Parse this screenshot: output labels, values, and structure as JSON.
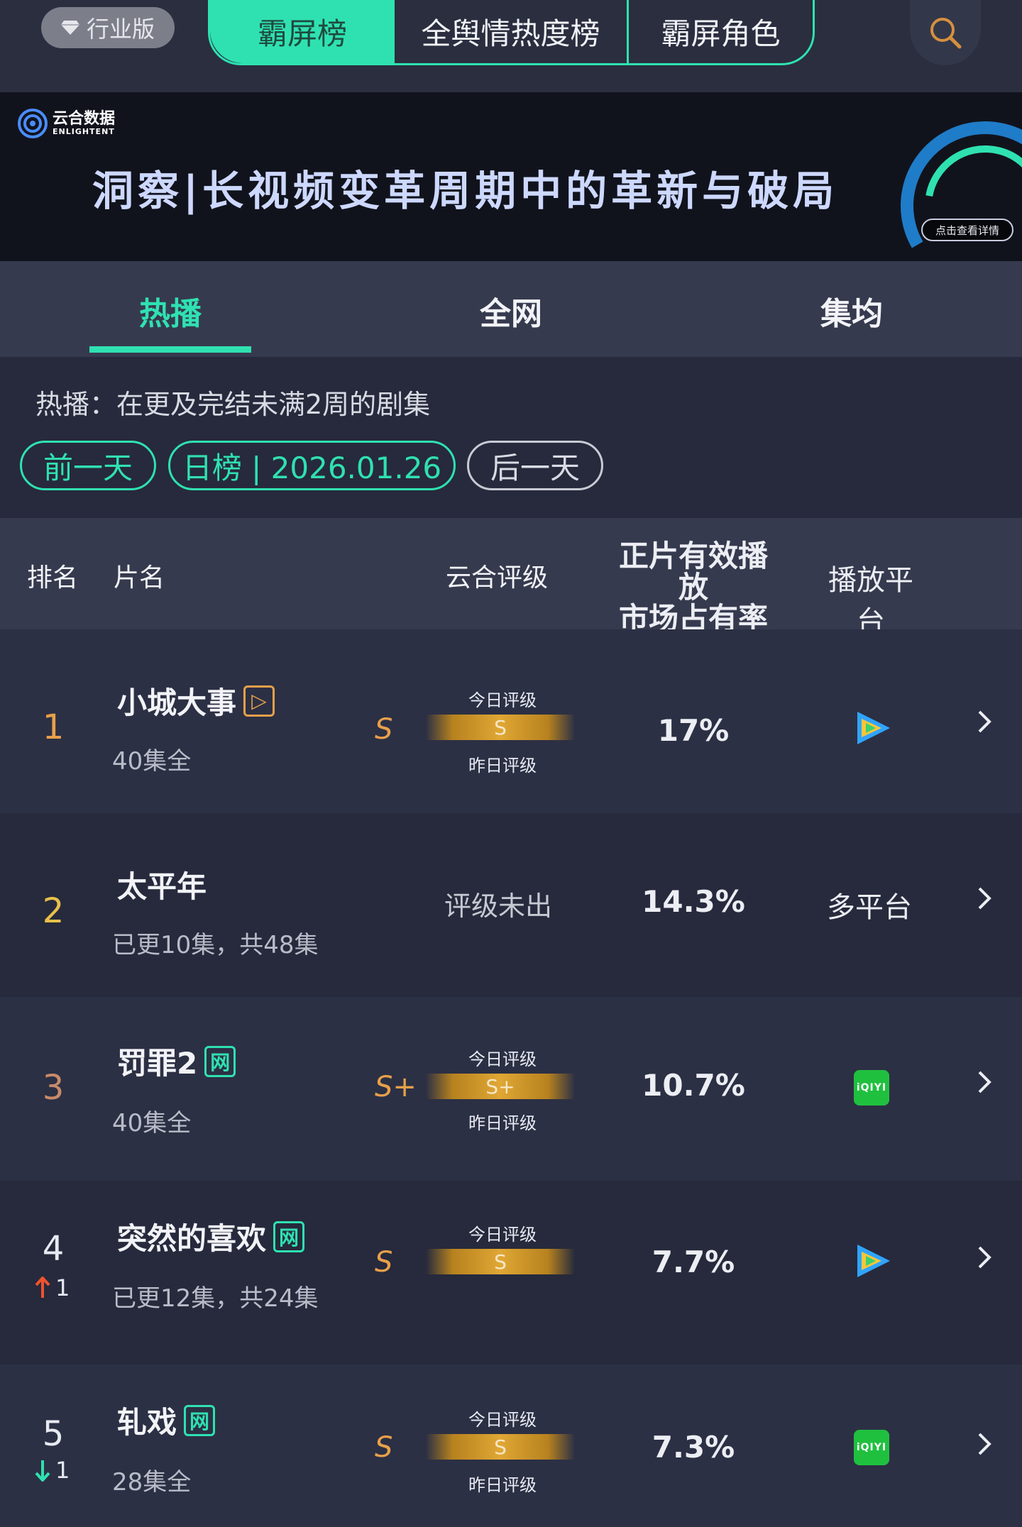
{
  "topbar": {
    "edition": "行业版",
    "tabs": [
      "霸屏榜",
      "全舆情热度榜",
      "霸屏角色"
    ],
    "accent": "#2fe1b1"
  },
  "banner": {
    "brand_name": "云合数据",
    "brand_sub": "ENLIGHTENT",
    "title": "洞察|长视频变革周期中的革新与破局",
    "detail": "点击查看详情"
  },
  "subtabs": [
    "热播",
    "全网",
    "集均"
  ],
  "filter": {
    "description": "热播：在更及完结未满2周的剧集",
    "prev": "前一天",
    "date": "日榜 | 2026.01.26",
    "next": "后一天"
  },
  "table": {
    "headers": {
      "rank": "排名",
      "title": "片名",
      "rating": "云合评级",
      "share_line1": "正片有效播放",
      "share_line2": "市场占有率",
      "platform": "播放平台"
    },
    "labels": {
      "today": "今日评级",
      "yesterday": "昨日评级"
    },
    "rows": [
      {
        "rank": "1",
        "title": "小城大事",
        "badge": "▷",
        "episodes": "40集全",
        "grade": "S",
        "bar": "S",
        "share": "17%",
        "platform": "tencent-video-icon"
      },
      {
        "rank": "2",
        "title": "太平年",
        "episodes": "已更10集，共48集",
        "no_grade": "评级未出",
        "share": "14.3%",
        "platform_text": "多平台"
      },
      {
        "rank": "3",
        "title": "罚罪2",
        "badge": "网",
        "episodes": "40集全",
        "grade": "S+",
        "bar": "S+",
        "share": "10.7%",
        "platform_logo": "iQIYI"
      },
      {
        "rank": "4",
        "change": "1",
        "title": "突然的喜欢",
        "badge": "网",
        "episodes": "已更12集，共24集",
        "grade": "S",
        "bar": "S",
        "share": "7.7%",
        "platform": "tencent-video-icon"
      },
      {
        "rank": "5",
        "change": "1",
        "title": "轧戏",
        "badge": "网",
        "episodes": "28集全",
        "grade": "S",
        "bar": "S",
        "share": "7.3%",
        "platform_logo": "iQIYI"
      }
    ]
  }
}
